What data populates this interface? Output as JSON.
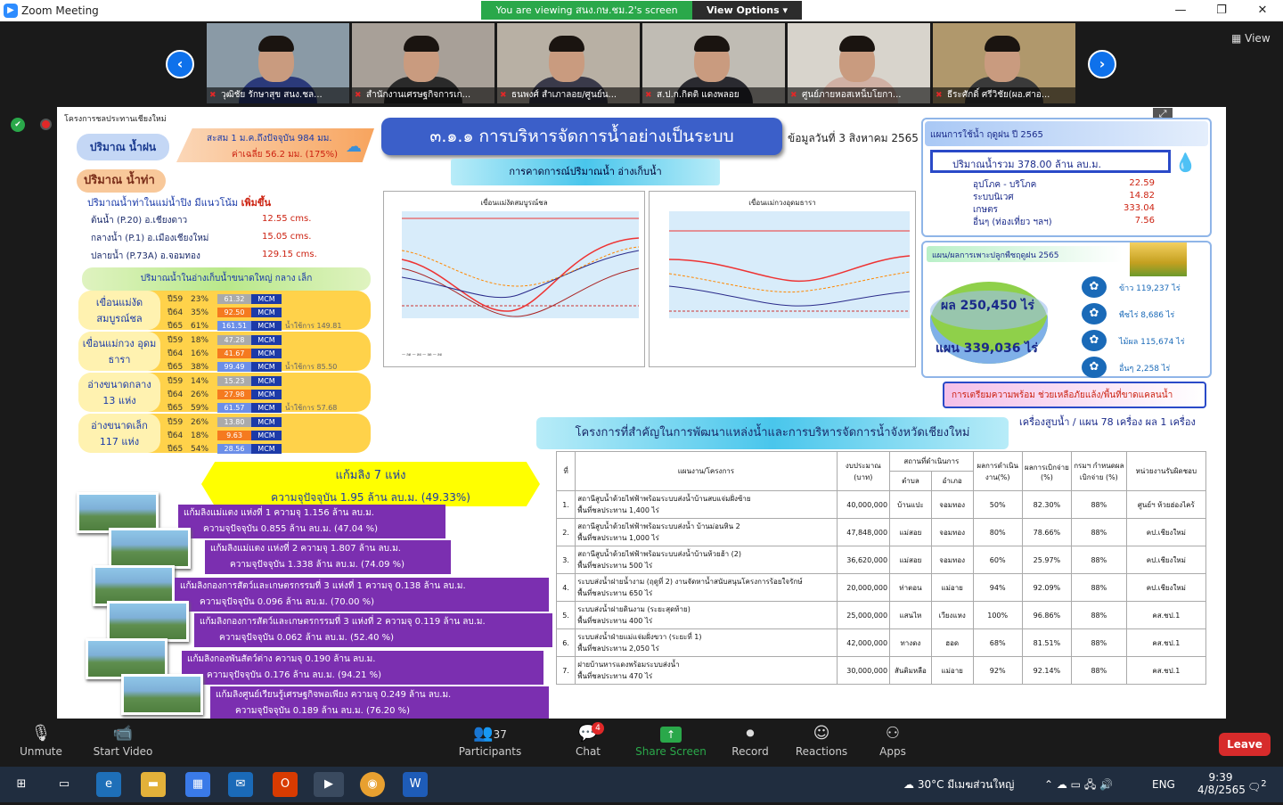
{
  "window": {
    "title": "Zoom Meeting"
  },
  "banner": {
    "viewing": "You are viewing สนง.กษ.ชม.2's screen",
    "view_options": "View Options ▾"
  },
  "gallery": {
    "view_label": "View",
    "participants": [
      {
        "name": "วุฒิชัย รักษาสุข สนง.ชล...",
        "shirt": "#2b3a7a",
        "bg": "#8a9aa6"
      },
      {
        "name": "สำนักงานเศรษฐกิจการเก...",
        "shirt": "#2a2a2a",
        "bg": "#a8a098"
      },
      {
        "name": "ธนพงศ์ สำเภาลอย/ศูนย์น...",
        "shirt": "#3a3a4a",
        "bg": "#b8b0a4"
      },
      {
        "name": "ส.ป.ก.กิตติ แดงพลอย",
        "shirt": "#2a2a30",
        "bg": "#c0bcb4"
      },
      {
        "name": "ศูนย์ภายหอสเหน็บโยกา...",
        "shirt": "#d0b0a4",
        "bg": "#d8d4cc"
      },
      {
        "name": "ธีระศักดิ์ ศรีวิชัย(ผอ.ศาอ...",
        "shirt": "#3a3a3a",
        "bg": "#b0986c"
      }
    ]
  },
  "slide": {
    "org": "โครงการชลประทานเชียงใหม่",
    "title": "๓.๑.๑ การบริหารจัดการน้ำอย่างเป็นระบบ",
    "date": "ข้อมูลวันที่ 3 สิงหาคม 2565",
    "rain_label": "ปริมาณ น้ำฝน",
    "rain_line1": "สะสม 1 ม.ค.ถึงปัจจุบัน 984 มม.",
    "rain_line2": "ค่าเฉลี่ย 56.2 มม. (175%)",
    "runoff_label": "ปริมาณ น้ำท่า",
    "runoff_subtitle": "ปริมาณน้ำท่าในแม่น้ำปิง มีแนวโน้ม",
    "runoff_trend": "เพิ่มขึ้น",
    "stations": [
      {
        "name": "ต้นน้ำ (P.20) อ.เชียงดาว",
        "value": "12.55 cms."
      },
      {
        "name": "กลางน้ำ (P.1) อ.เมืองเชียงใหม่",
        "value": "15.05 cms."
      },
      {
        "name": "ปลายน้ำ (P.73A) อ.จอมทอง",
        "value": "129.15 cms."
      }
    ],
    "storage_header": "ปริมาณน้ำในอ่างเก็บน้ำขนาดใหญ่ กลาง เล็ก",
    "forecast_bar": "การคาดการณ์ปริมาณน้ำ อ่างเก็บน้ำ",
    "reservoirs": [
      {
        "name": "เขื่อนแม่งัด สมบูรณ์ชล",
        "rows": [
          [
            "ปี59",
            "23%",
            "61.32"
          ],
          [
            "ปี64",
            "35%",
            "92.50"
          ],
          [
            "ปี65",
            "61%",
            "161.51"
          ]
        ],
        "usable": "น้ำใช้การ 149.81"
      },
      {
        "name": "เขื่อนแม่กวง อุดมธารา",
        "rows": [
          [
            "ปี59",
            "18%",
            "47.28"
          ],
          [
            "ปี64",
            "16%",
            "41.67"
          ],
          [
            "ปี65",
            "38%",
            "99.49"
          ]
        ],
        "usable": "น้ำใช้การ 85.50"
      },
      {
        "name": "อ่างขนาดกลาง 13 แห่ง",
        "rows": [
          [
            "ปี59",
            "14%",
            "15.23"
          ],
          [
            "ปี64",
            "26%",
            "27.98"
          ],
          [
            "ปี65",
            "59%",
            "61.57"
          ]
        ],
        "usable": "น้ำใช้การ 57.68"
      },
      {
        "name": "อ่างขนาดเล็ก 117 แห่ง",
        "rows": [
          [
            "ปี59",
            "26%",
            "13.80"
          ],
          [
            "ปี64",
            "18%",
            "9.63"
          ],
          [
            "ปี65",
            "54%",
            "28.56"
          ]
        ],
        "usable": ""
      }
    ],
    "mcm": "MCM",
    "monkey_cheek_title": "แก้มลิง 7 แห่ง",
    "monkey_cheek_total": "ความจุปัจจุบัน 1.95 ล้าน ลบ.ม. (49.33%)",
    "ponds": [
      {
        "l1": "แก้มลิงแม่แตง แห่งที่ 1   ความจุ 1.156 ล้าน ลบ.ม.",
        "l2": "ความจุปัจจุบัน 0.855 ล้าน ลบ.ม. (47.04 %)"
      },
      {
        "l1": "แก้มลิงแม่แตง แห่งที่ 2 ความจุ 1.807 ล้าน ลบ.ม.",
        "l2": "ความจุปัจจุบัน 1.338 ล้าน ลบ.ม. (74.09 %)"
      },
      {
        "l1": "แก้มลิงกองการสัตว์และเกษตรกรรมที่ 3 แห่งที่ 1 ความจุ 0.138 ล้าน ลบ.ม.",
        "l2": "ความจุปัจจุบัน 0.096 ล้าน ลบ.ม. (70.00 %)"
      },
      {
        "l1": "แก้มลิงกองการสัตว์และเกษตรกรรมที่ 3 แห่งที่ 2 ความจุ 0.119 ล้าน ลบ.ม.",
        "l2": "ความจุปัจจุบัน 0.062 ล้าน ลบ.ม. (52.40 %)"
      },
      {
        "l1": "แก้มลิงกองพันสัตว์ต่าง ความจุ 0.190 ล้าน ลบ.ม.",
        "l2": "ความจุปัจจุบัน 0.176 ล้าน ลบ.ม. (94.21 %)"
      },
      {
        "l1": "แก้มลิงศูนย์เรียนรู้เศรษฐกิจพอเพียง ความจุ 0.249 ล้าน ลบ.ม.",
        "l2": "ความจุปัจจุบัน 0.189 ล้าน ลบ.ม. (76.20 %)"
      }
    ],
    "chart1_title": "เขื่อนแม่งัดสมบูรณ์ชล",
    "chart2_title": "เขื่อนแม่กวงอุดมธารา",
    "plan_title": "แผนการใช้น้ำ ฤดูฝน ปี 2565",
    "plan_total": "ปริมาณน้ำรวม 378.00 ล้าน ลบ.ม.",
    "plan_items": [
      {
        "label": "อุปโภค - บริโภค",
        "value": "22.59"
      },
      {
        "label": "ระบบนิเวศ",
        "value": "14.82"
      },
      {
        "label": "เกษตร",
        "value": "333.04"
      },
      {
        "label": "อื่นๆ (ท่องเที่ยว ฯลฯ)",
        "value": "7.56"
      }
    ],
    "crop_title": "แผน/ผลการเพาะปลูกพืชฤดูฝน 2565",
    "crop_result": "ผล 250,450 ไร่",
    "crop_plan": "แผน 339,036 ไร่",
    "crops": [
      {
        "label": "ข้าว 119,237 ไร่"
      },
      {
        "label": "พืชไร่ 8,686 ไร่"
      },
      {
        "label": "ไม้ผล 115,674 ไร่"
      },
      {
        "label": "อื่นๆ 2,258 ไร่"
      }
    ],
    "prep_title": "การเตรียมความพร้อม ช่วยเหลือภัยแล้ง/พื้นที่ขาดแคลนน้ำ",
    "prep_value": "เครื่องสูบน้ำ / แผน 78 เครื่อง ผล 1 เครื่อง",
    "projects_title": "โครงการที่สำคัญในการพัฒนาแหล่งน้ำและการบริหารจัดการน้ำจังหวัดเชียงใหม่",
    "table_headers": [
      "ที่",
      "แผนงาน/โครงการ",
      "งบประมาณ (บาท)",
      "ตำบล",
      "อำเภอ",
      "ผลการดำเนินงาน(%)",
      "ผลการเบิกจ่าย (%)",
      "กรมฯ กำหนดผลเบิกจ่าย (%)",
      "หน่วยงานรับผิดชอบ"
    ],
    "table_location_header": "สถานที่ดำเนินการ",
    "projects": [
      [
        "1.",
        "สถานีสูบน้ำด้วยไฟฟ้าพร้อมระบบส่งน้ำบ้านสบแจ่มฝั่งซ้าย",
        "พื้นที่ชลประทาน 1,400 ไร่",
        "40,000,000",
        "บ้านแปะ",
        "จอมทอง",
        "50%",
        "82.30%",
        "88%",
        "ศูนย์ฯ ห้วยฮ่องไคร้"
      ],
      [
        "2.",
        "สถานีสูบน้ำด้วยไฟฟ้าพร้อมระบบส่งน้ำ บ้านม่อนหิน 2",
        "พื้นที่ชลประทาน 1,000 ไร่",
        "47,848,000",
        "แม่สอย",
        "จอมทอง",
        "80%",
        "78.66%",
        "88%",
        "คป.เชียงใหม่"
      ],
      [
        "3.",
        "สถานีสูบน้ำด้วยไฟฟ้าพร้อมระบบส่งน้ำบ้านห้วยฮ้า (2)",
        "พื้นที่ชลประทาน 500 ไร่",
        "36,620,000",
        "แม่สอย",
        "จอมทอง",
        "60%",
        "25.97%",
        "88%",
        "คป.เชียงใหม่"
      ],
      [
        "4.",
        "ระบบส่งน้ำฝายน้ำงาม (ฤดูที่ 2) งานจัดหาน้ำสนับสนุนโครงการร้อยใจรักษ์",
        "พื้นที่ชลประทาน 650 ไร่",
        "20,000,000",
        "ท่าตอน",
        "แม่อาย",
        "94%",
        "92.09%",
        "88%",
        "คป.เชียงใหม่"
      ],
      [
        "5.",
        "ระบบส่งน้ำฝายดินงาม (ระยะสุดท้าย)",
        "พื้นที่ชลประทาน 400 ไร่",
        "25,000,000",
        "แสนไห",
        "เวียงแหง",
        "100%",
        "96.86%",
        "88%",
        "คส.ชป.1"
      ],
      [
        "6.",
        "ระบบส่งน้ำฝ่ายแม่แจ่มฝั่งขวา (ระยะที่ 1)",
        "พื้นที่ชลประทาน 2,050 ไร่",
        "42,000,000",
        "ทางดง",
        "ฮอด",
        "68%",
        "81.51%",
        "88%",
        "คส.ชป.1"
      ],
      [
        "7.",
        "ฝายบ้านหารแดงพร้อมระบบส่งน้ำ",
        "พื้นที่ชลประทาน 470 ไร่",
        "30,000,000",
        "สันติมหลือ",
        "แม่อาย",
        "92%",
        "92.14%",
        "88%",
        "คส.ชป.1"
      ]
    ]
  },
  "toolbar": {
    "unmute": "Unmute",
    "start_video": "Start Video",
    "participants": "Participants",
    "participants_count": "37",
    "chat": "Chat",
    "chat_badge": "4",
    "share": "Share Screen",
    "record": "Record",
    "reactions": "Reactions",
    "apps": "Apps",
    "leave": "Leave"
  },
  "taskbar": {
    "weather": "30°C มีเมฆส่วนใหญ่",
    "lang": "ENG",
    "time": "9:39",
    "date": "4/8/2565",
    "notif": "2"
  },
  "colors": {
    "zoom_blue": "#0e71eb",
    "share_green": "#2aa84a",
    "leave_red": "#d72b2b",
    "purple": "#7b2fb0"
  }
}
